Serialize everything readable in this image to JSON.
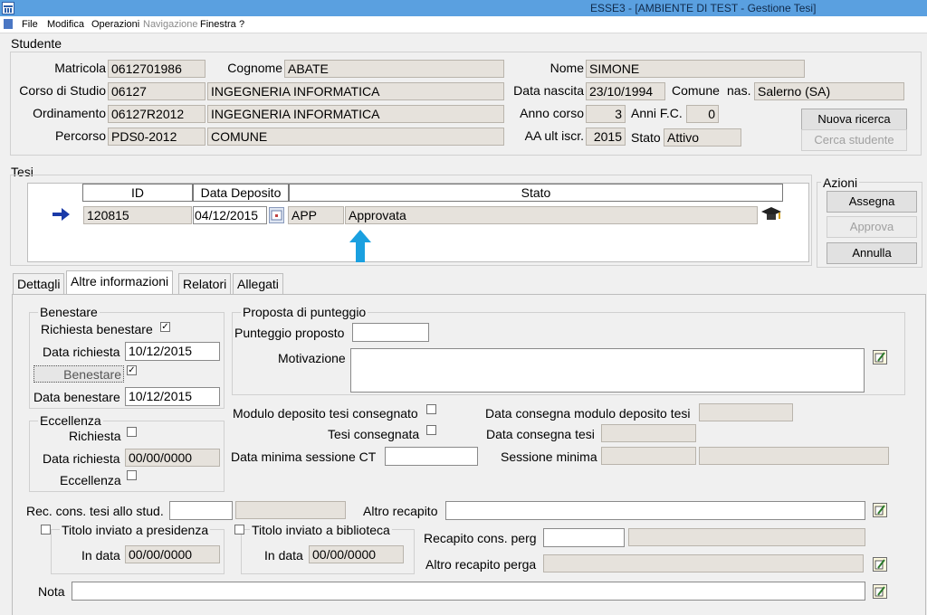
{
  "window": {
    "title": "ESSE3 - [AMBIENTE DI TEST - Gestione Tesi]"
  },
  "menu": [
    "File",
    "Modifica",
    "Operazioni",
    "Navigazione",
    "Finestra",
    "?"
  ],
  "studente": {
    "group": "Studente",
    "matricola_lbl": "Matricola",
    "matricola": "0612701986",
    "cognome_lbl": "Cognome",
    "cognome": "ABATE",
    "nome_lbl": "Nome",
    "nome": "SIMONE",
    "cds_lbl": "Corso di Studio",
    "cds_code": "06127",
    "cds_name": "INGEGNERIA INFORMATICA",
    "nascita_lbl": "Data nascita",
    "nascita": "23/10/1994",
    "comune_lbl": "Comune",
    "nas_lbl": "nas.",
    "comune": "Salerno (SA)",
    "ord_lbl": "Ordinamento",
    "ord_code": "06127R2012",
    "ord_name": "INGEGNERIA INFORMATICA",
    "anno_lbl": "Anno corso",
    "anno": "3",
    "fc_lbl": "Anni F.C.",
    "fc": "0",
    "perc_lbl": "Percorso",
    "perc_code": "PDS0-2012",
    "perc_name": "COMUNE",
    "aa_lbl": "AA ult iscr.",
    "aa": "2015",
    "stato_lbl": "Stato",
    "stato": "Attivo",
    "nuova_ricerca": "Nuova ricerca",
    "cerca_studente": "Cerca studente"
  },
  "tesi": {
    "group": "Tesi",
    "col_id": "ID",
    "col_data": "Data Deposito",
    "col_stato": "Stato",
    "id": "120815",
    "data": "04/12/2015",
    "stato_code": "APP",
    "stato_desc": "Approvata"
  },
  "azioni": {
    "group": "Azioni",
    "assegna": "Assegna",
    "approva": "Approva",
    "annulla": "Annulla"
  },
  "tabs": [
    "Dettagli",
    "Altre informazioni",
    "Relatori",
    "Allegati"
  ],
  "benestare": {
    "group": "Benestare",
    "richiesta_lbl": "Richiesta benestare",
    "data_rich_lbl": "Data richiesta",
    "data_rich": "10/12/2015",
    "benestare_btn": "Benestare",
    "data_ben_lbl": "Data benestare",
    "data_ben": "10/12/2015"
  },
  "eccellenza": {
    "group": "Eccellenza",
    "richiesta_lbl": "Richiesta",
    "data_rich_lbl": "Data richiesta",
    "data_rich": "00/00/0000",
    "eccellenza_lbl": "Eccellenza"
  },
  "punteggio": {
    "group": "Proposta di punteggio",
    "proposto_lbl": "Punteggio proposto",
    "proposto": "",
    "motivazione_lbl": "Motivazione",
    "motivazione": ""
  },
  "deposito": {
    "modulo_lbl": "Modulo deposito tesi consegnato",
    "data_modulo_lbl": "Data consegna modulo deposito tesi",
    "tesi_cons_lbl": "Tesi consegnata",
    "data_tesi_lbl": "Data consegna tesi",
    "min_sess_ct_lbl": "Data minima sessione CT",
    "sess_min_lbl": "Sessione minima"
  },
  "recapiti": {
    "rec_lbl": "Rec. cons. tesi allo stud.",
    "altro_lbl": "Altro recapito",
    "pres_lbl": "Titolo inviato a presidenza",
    "pres_data_lbl": "In data",
    "pres_data": "00/00/0000",
    "bib_lbl": "Titolo inviato a biblioteca",
    "bib_data_lbl": "In data",
    "bib_data": "00/00/0000",
    "perg_lbl": "Recapito cons. perg",
    "altro_perg_lbl": "Altro recapito perga",
    "nota_lbl": "Nota"
  }
}
